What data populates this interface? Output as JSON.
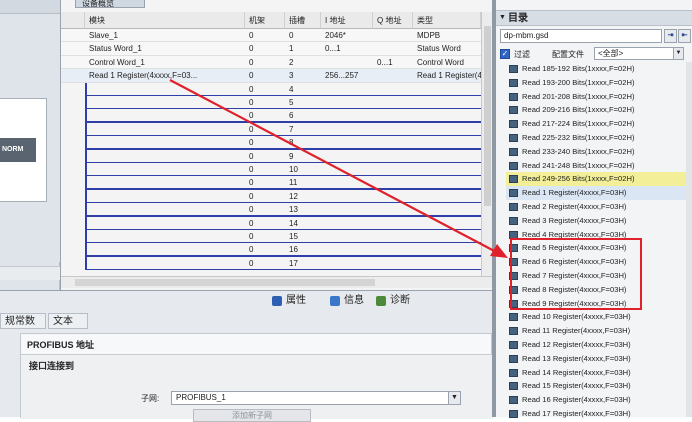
{
  "overview": {
    "tab_label": "设备概览",
    "columns": [
      "",
      "模块",
      "机架",
      "插槽",
      "I 地址",
      "Q 地址",
      "类型"
    ],
    "used_rows": [
      {
        "module": "Slave_1",
        "rack": "0",
        "slot": "0",
        "i_addr": "2046*",
        "q_addr": "",
        "type": "MDPB"
      },
      {
        "module": "Status Word_1",
        "rack": "0",
        "slot": "1",
        "i_addr": "0...1",
        "q_addr": "",
        "type": "Status Word"
      },
      {
        "module": "Control Word_1",
        "rack": "0",
        "slot": "2",
        "i_addr": "",
        "q_addr": "0...1",
        "type": "Control Word"
      },
      {
        "module": "Read 1 Register(4xxxx,F=03...",
        "rack": "0",
        "slot": "3",
        "i_addr": "256...257",
        "q_addr": "",
        "type": "Read 1 Register(4xx..."
      }
    ],
    "empty_rows": [
      {
        "rack": "0",
        "slot": "4"
      },
      {
        "rack": "0",
        "slot": "5"
      },
      {
        "rack": "0",
        "slot": "6"
      },
      {
        "rack": "0",
        "slot": "7"
      },
      {
        "rack": "0",
        "slot": "8"
      },
      {
        "rack": "0",
        "slot": "9"
      },
      {
        "rack": "0",
        "slot": "10"
      },
      {
        "rack": "0",
        "slot": "11"
      },
      {
        "rack": "0",
        "slot": "12"
      },
      {
        "rack": "0",
        "slot": "13"
      },
      {
        "rack": "0",
        "slot": "14"
      },
      {
        "rack": "0",
        "slot": "15"
      },
      {
        "rack": "0",
        "slot": "16"
      },
      {
        "rack": "0",
        "slot": "17"
      }
    ]
  },
  "topology": {
    "device_tag": "NORM"
  },
  "inspector": {
    "tabs": [
      "属性",
      "信息",
      "诊断"
    ],
    "subtabs": [
      "规常数",
      "文本"
    ],
    "title": "PROFIBUS 地址",
    "section_title": "接口连接到",
    "subnet_label": "子网:",
    "subnet_value": "PROFIBUS_1",
    "add_subnet_label": "添加新子网"
  },
  "catalog": {
    "title": "目录",
    "search_value": "dp-mbm.gsd",
    "filter_label": "过滤",
    "profile_label": "配置文件",
    "profile_value": "<全部>",
    "items": [
      "Read 185-192 Bits(1xxxx,F=02H)",
      "Read 193-200 Bits(1xxxx,F=02H)",
      "Read 201-208 Bits(1xxxx,F=02H)",
      "Read 209-216 Bits(1xxxx,F=02H)",
      "Read 217-224 Bits(1xxxx,F=02H)",
      "Read 225-232 Bits(1xxxx,F=02H)",
      "Read 233-240 Bits(1xxxx,F=02H)",
      "Read 241-248 Bits(1xxxx,F=02H)",
      "Read 249-256 Bits(1xxxx,F=02H)",
      "Read 1 Register(4xxxx,F=03H)",
      "Read 2 Register(4xxxx,F=03H)",
      "Read 3 Register(4xxxx,F=03H)",
      "Read 4 Register(4xxxx,F=03H)",
      "Read 5 Register(4xxxx,F=03H)",
      "Read 6 Register(4xxxx,F=03H)",
      "Read 7 Register(4xxxx,F=03H)",
      "Read 8 Register(4xxxx,F=03H)",
      "Read 9 Register(4xxxx,F=03H)",
      "Read 10 Register(4xxxx,F=03H)",
      "Read 11 Register(4xxxx,F=03H)",
      "Read 12 Register(4xxxx,F=03H)",
      "Read 13 Register(4xxxx,F=03H)",
      "Read 14 Register(4xxxx,F=03H)",
      "Read 15 Register(4xxxx,F=03H)",
      "Read 16 Register(4xxxx,F=03H)",
      "Read 17 Register(4xxxx,F=03H)"
    ]
  },
  "colors": {
    "annotation_red": "#e0202a",
    "slot_line_blue": "#2e3fa7",
    "selection_yellow": "#f3ef98"
  }
}
